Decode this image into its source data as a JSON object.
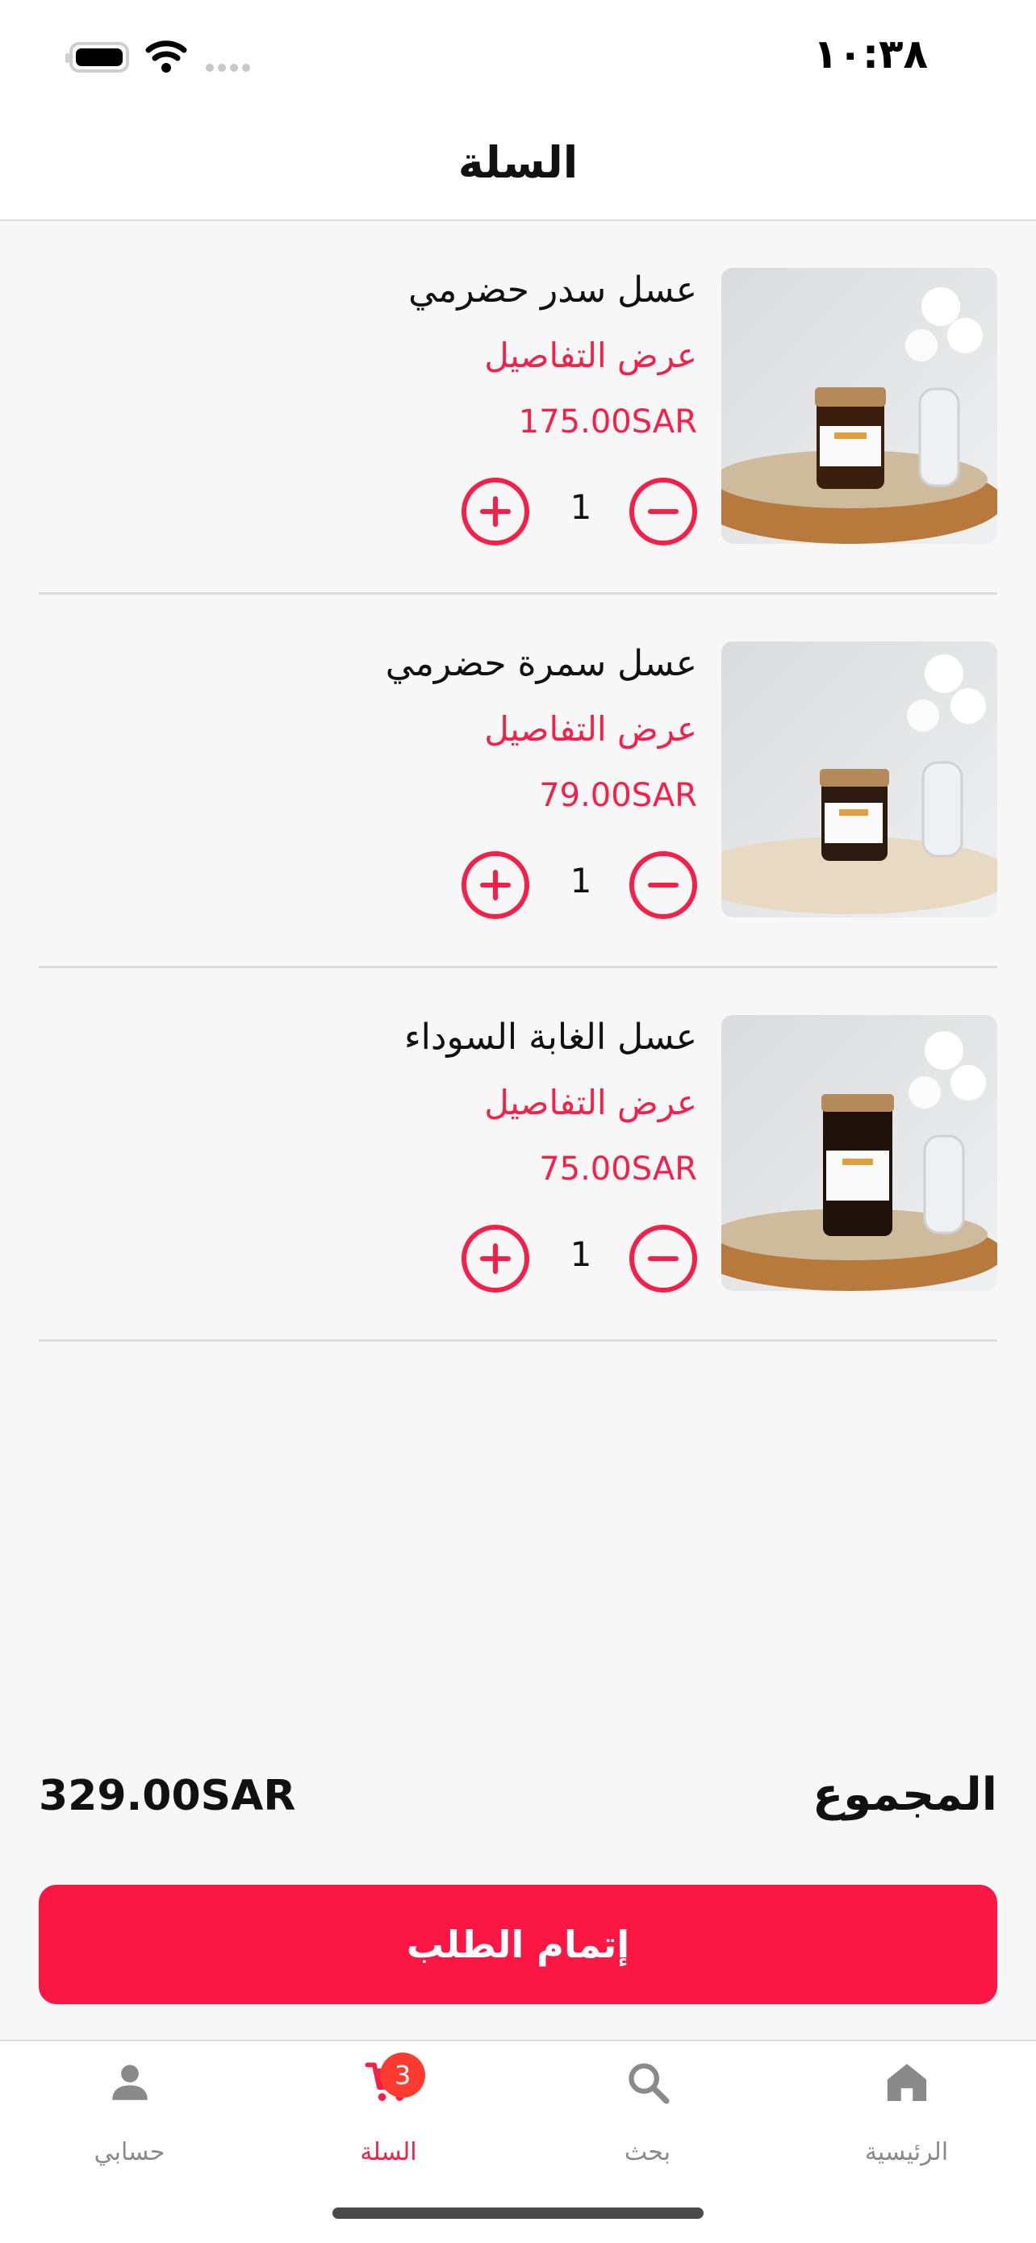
{
  "status_bar": {
    "time": "١٠:٣٨"
  },
  "header": {
    "title": "السلة"
  },
  "cart": {
    "items": [
      {
        "name": "عسل سدر حضرمي",
        "details": "عرض التفاصيل",
        "price": "175.00SAR",
        "quantity": "1"
      },
      {
        "name": "عسل سمرة حضرمي",
        "details": "عرض التفاصيل",
        "price": "79.00SAR",
        "quantity": "1"
      },
      {
        "name": "عسل الغابة السوداء",
        "details": "عرض التفاصيل",
        "price": "75.00SAR",
        "quantity": "1"
      }
    ]
  },
  "summary": {
    "total_label": "المجموع",
    "total_value": "329.00SAR"
  },
  "checkout": {
    "label": "إتمام الطلب"
  },
  "tabs": [
    {
      "label": "الرئيسية",
      "icon": "home-icon"
    },
    {
      "label": "بحث",
      "icon": "search-icon"
    },
    {
      "label": "السلة",
      "icon": "cart-icon",
      "badge": "3",
      "active": true
    },
    {
      "label": "حسابي",
      "icon": "person-icon"
    }
  ],
  "colors": {
    "accent": "#f4204a",
    "button": "#fb1744",
    "badge": "#ff3b30"
  }
}
